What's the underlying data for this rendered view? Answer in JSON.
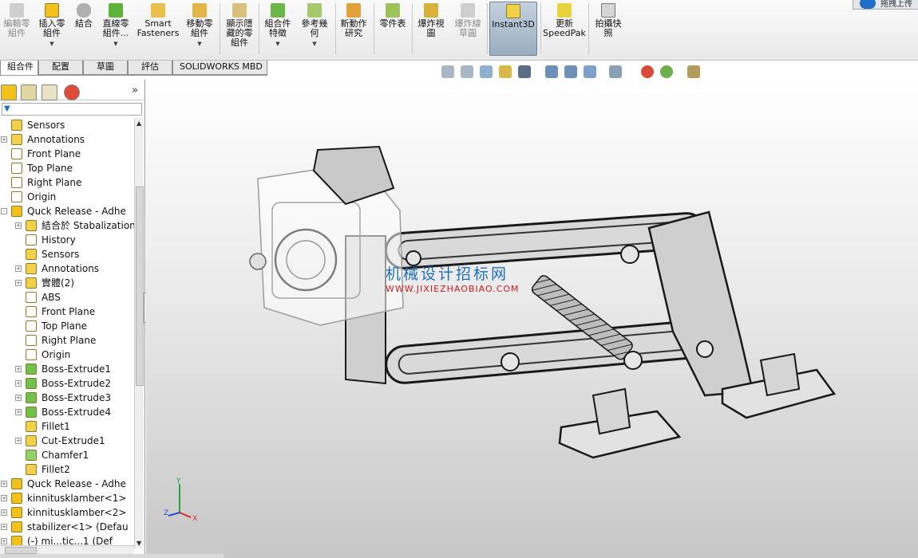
{
  "ribbon": {
    "buttons": [
      {
        "name": "edit-component",
        "label": "編輯零\n組件",
        "disabled": true,
        "icon": "edit-component-icon"
      },
      {
        "name": "insert-component",
        "label": "插入零\n組件",
        "disabled": false,
        "icon": "insert-component-icon"
      },
      {
        "name": "mate",
        "label": "結合",
        "disabled": false,
        "icon": "mate-icon"
      },
      {
        "name": "linear-pattern",
        "label": "直線零\n組件...",
        "disabled": false,
        "icon": "linear-pattern-icon"
      },
      {
        "name": "smart-fasteners",
        "label": "Smart\nFasteners",
        "disabled": false,
        "icon": "smart-fasteners-icon"
      },
      {
        "name": "move-component",
        "label": "移動零\n組件",
        "disabled": false,
        "icon": "move-component-icon"
      },
      {
        "name": "show-hidden",
        "label": "顯示隱\n藏的零\n組件",
        "disabled": false,
        "icon": "show-hidden-icon"
      },
      {
        "name": "assembly-features",
        "label": "組合件\n特徵",
        "disabled": false,
        "icon": "assembly-features-icon"
      },
      {
        "name": "reference-geometry",
        "label": "參考幾\n何",
        "disabled": false,
        "icon": "reference-geometry-icon"
      },
      {
        "name": "new-motion-study",
        "label": "新動作\n研究",
        "disabled": false,
        "icon": "motion-study-icon"
      },
      {
        "name": "bom",
        "label": "零件表",
        "disabled": false,
        "icon": "bom-icon"
      },
      {
        "name": "exploded-view",
        "label": "爆炸視\n圖",
        "disabled": false,
        "icon": "exploded-view-icon"
      },
      {
        "name": "explode-line-sketch",
        "label": "爆炸線\n草圖",
        "disabled": true,
        "icon": "explode-line-icon"
      },
      {
        "name": "instant3d",
        "label": "Instant3D",
        "disabled": false,
        "icon": "instant3d-icon"
      },
      {
        "name": "update-speedpak",
        "label": "更新\nSpeedPak",
        "disabled": false,
        "icon": "speedpak-icon"
      },
      {
        "name": "take-snapshot",
        "label": "拍攝快\n照",
        "disabled": false,
        "icon": "snapshot-icon"
      }
    ],
    "cloud_label": "拖拽上传"
  },
  "tabs": [
    "組合件",
    "配置",
    "草圖",
    "評估",
    "SOLIDWORKS MBD"
  ],
  "tree": {
    "items": [
      {
        "label": "Sensors",
        "indent": 0,
        "expander": "",
        "icon": "sensor-icon"
      },
      {
        "label": "Annotations",
        "indent": 0,
        "expander": "+",
        "icon": "annotation-icon"
      },
      {
        "label": "Front Plane",
        "indent": 0,
        "expander": "",
        "icon": "plane-icon"
      },
      {
        "label": "Top Plane",
        "indent": 0,
        "expander": "",
        "icon": "plane-icon"
      },
      {
        "label": "Right Plane",
        "indent": 0,
        "expander": "",
        "icon": "plane-icon"
      },
      {
        "label": "Origin",
        "indent": 0,
        "expander": "",
        "icon": "origin-icon"
      },
      {
        "label": "Quck Release - Adhe",
        "indent": 0,
        "expander": "-",
        "icon": "part-icon"
      },
      {
        "label": "結合於 Stabalization",
        "indent": 1,
        "expander": "+",
        "icon": "mates-icon"
      },
      {
        "label": "History",
        "indent": 1,
        "expander": "",
        "icon": "history-icon"
      },
      {
        "label": "Sensors",
        "indent": 1,
        "expander": "",
        "icon": "sensor-icon"
      },
      {
        "label": "Annotations",
        "indent": 1,
        "expander": "+",
        "icon": "annotation-icon"
      },
      {
        "label": "實體(2)",
        "indent": 1,
        "expander": "+",
        "icon": "solid-bodies-icon"
      },
      {
        "label": "ABS",
        "indent": 1,
        "expander": "",
        "icon": "material-icon"
      },
      {
        "label": "Front Plane",
        "indent": 1,
        "expander": "",
        "icon": "plane-icon"
      },
      {
        "label": "Top Plane",
        "indent": 1,
        "expander": "",
        "icon": "plane-icon"
      },
      {
        "label": "Right Plane",
        "indent": 1,
        "expander": "",
        "icon": "plane-icon"
      },
      {
        "label": "Origin",
        "indent": 1,
        "expander": "",
        "icon": "origin-icon"
      },
      {
        "label": "Boss-Extrude1",
        "indent": 1,
        "expander": "+",
        "icon": "extrude-icon"
      },
      {
        "label": "Boss-Extrude2",
        "indent": 1,
        "expander": "+",
        "icon": "extrude-icon"
      },
      {
        "label": "Boss-Extrude3",
        "indent": 1,
        "expander": "+",
        "icon": "extrude-icon"
      },
      {
        "label": "Boss-Extrude4",
        "indent": 1,
        "expander": "+",
        "icon": "extrude-icon"
      },
      {
        "label": "Fillet1",
        "indent": 1,
        "expander": "",
        "icon": "fillet-icon"
      },
      {
        "label": "Cut-Extrude1",
        "indent": 1,
        "expander": "+",
        "icon": "cut-extrude-icon"
      },
      {
        "label": "Chamfer1",
        "indent": 1,
        "expander": "",
        "icon": "chamfer-icon"
      },
      {
        "label": "Fillet2",
        "indent": 1,
        "expander": "",
        "icon": "fillet-icon"
      },
      {
        "label": "Quck Release - Adhe",
        "indent": 0,
        "expander": "+",
        "icon": "part-icon"
      },
      {
        "label": "kinnitusklamber<1>",
        "indent": 0,
        "expander": "+",
        "icon": "part-icon"
      },
      {
        "label": "kinnitusklamber<2>",
        "indent": 0,
        "expander": "+",
        "icon": "part-icon"
      },
      {
        "label": "stabilizer<1> (Defau",
        "indent": 0,
        "expander": "+",
        "icon": "part-icon"
      },
      {
        "label": "(-) mi...tic...1 (Def",
        "indent": 0,
        "expander": "+",
        "icon": "part-icon"
      }
    ]
  },
  "viewport": {
    "watermark_line1": "机械设计招标网",
    "watermark_line2": "WWW.JIXIEZHAOBIAO.COM",
    "triad_labels": {
      "x": "X",
      "y": "Y",
      "z": "Z"
    }
  },
  "colors": {
    "ribbon_bg": "#ececec",
    "viewport_top": "#ffffff",
    "viewport_bottom": "#c7c7c7",
    "selection": "#1f6fc2",
    "watermark_blue": "#1f6fc2",
    "watermark_red": "#d21a1a",
    "part_yellow": "#f2c21b"
  }
}
